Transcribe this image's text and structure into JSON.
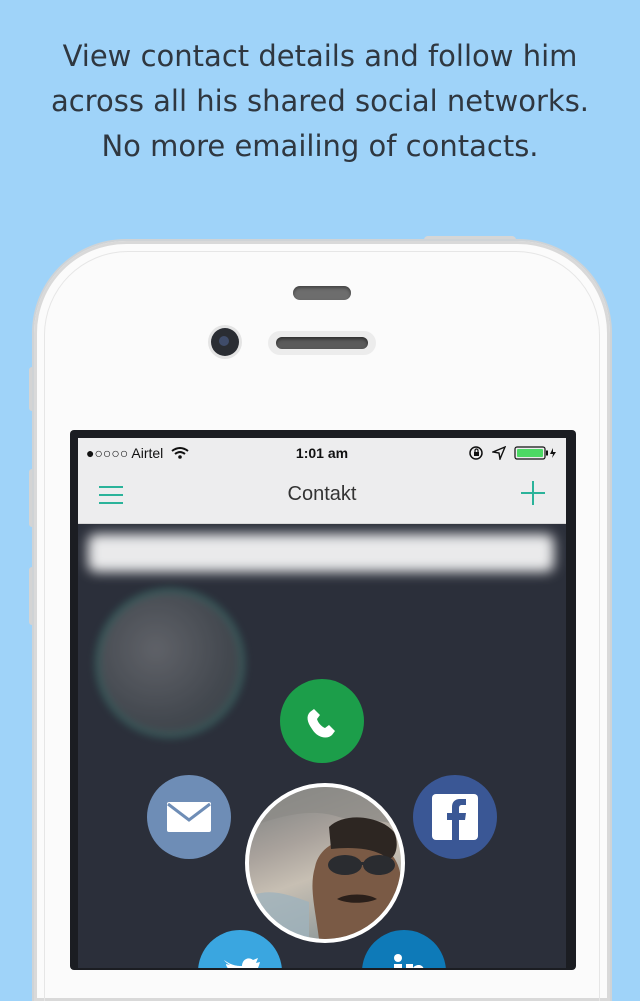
{
  "caption": {
    "line1": "View contact details and follow him",
    "line2": "across all his shared social networks.",
    "line3": "No more emailing of contacts."
  },
  "status_bar": {
    "carrier": "●○○○○ Airtel",
    "time": "1:01 am"
  },
  "nav": {
    "title": "Contakt"
  },
  "colors": {
    "background": "#9fd3f9",
    "accent": "#2bb39a",
    "call": "#1c9e4a",
    "mail": "#6e8db6",
    "facebook": "#3a5795",
    "twitter": "#3aa6e0",
    "linkedin": "#0e7ab8"
  },
  "icons": [
    "menu-icon",
    "plus-icon",
    "wifi-icon",
    "rotation-lock-icon",
    "location-icon",
    "battery-icon",
    "phone-icon",
    "mail-icon",
    "facebook-icon",
    "twitter-icon",
    "linkedin-icon"
  ]
}
